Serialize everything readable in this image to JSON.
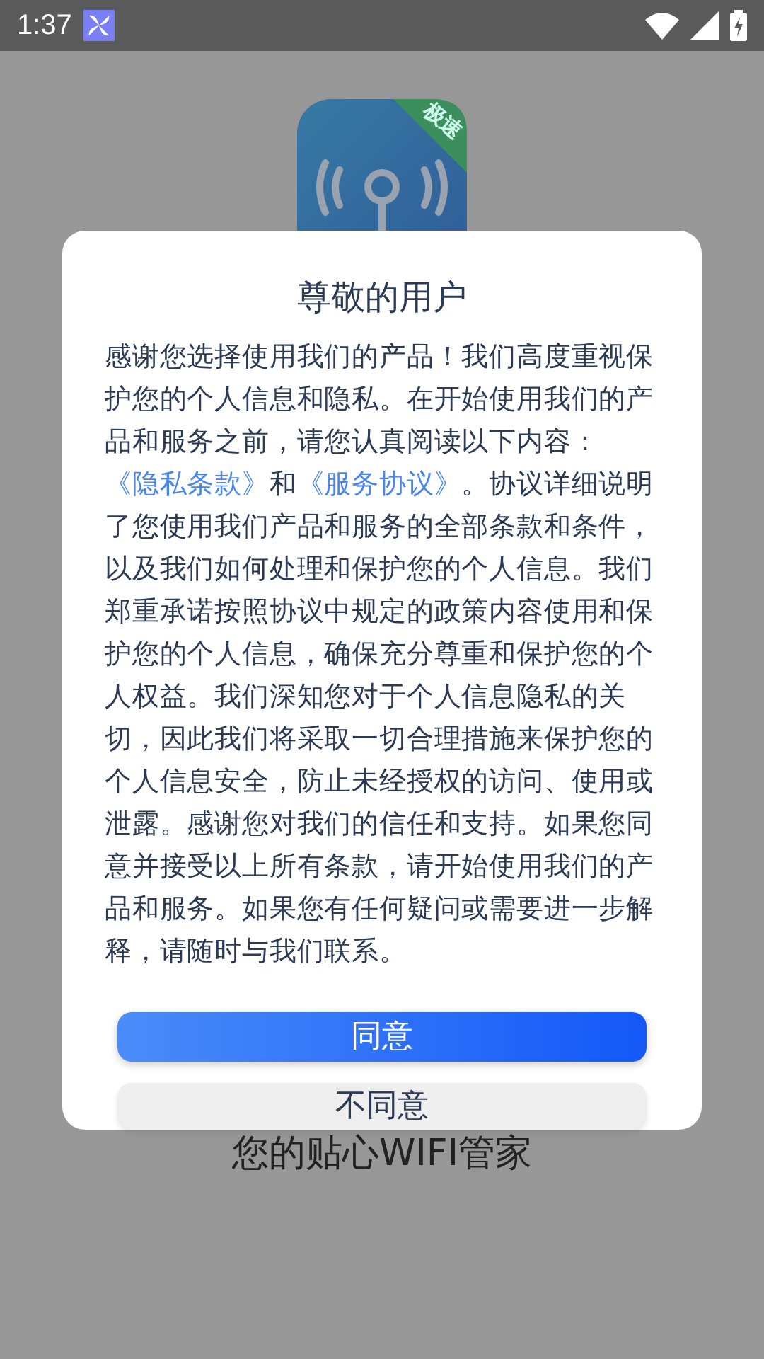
{
  "status_bar": {
    "time": "1:37"
  },
  "app": {
    "badge": "极速",
    "slogan": "您的贴心WIFI管家"
  },
  "dialog": {
    "title": "尊敬的用户",
    "message": [
      {
        "kind": "text",
        "text": "感谢您选择使用我们的产品！我们高度重视保护您的个人信息和隐私。在开始使用我们的产品和服务之前，请您认真阅读以下内容："
      },
      {
        "kind": "link",
        "text": "《隐私条款》"
      },
      {
        "kind": "text",
        "text": "和"
      },
      {
        "kind": "link",
        "text": "《服务协议》"
      },
      {
        "kind": "text",
        "text": "。协议详细说明了您使用我们产品和服务的全部条款和条件，以及我们如何处理和保护您的个人信息。我们郑重承诺按照协议中规定的政策内容使用和保护您的个人信息，确保充分尊重和保护您的个人权益。我们深知您对于个人信息隐私的关切，因此我们将采取一切合理措施来保护您的个人信息安全，防止未经授权的访问、使用或泄露。感谢您对我们的信任和支持。如果您同意并接受以上所有条款，请开始使用我们的产品和服务。如果您有任何疑问或需要进一步解释，请随时与我们联系。"
      }
    ],
    "buttons": [
      {
        "kind": "primary",
        "label": "同意"
      },
      {
        "kind": "secondary",
        "label": "不同意"
      }
    ]
  }
}
